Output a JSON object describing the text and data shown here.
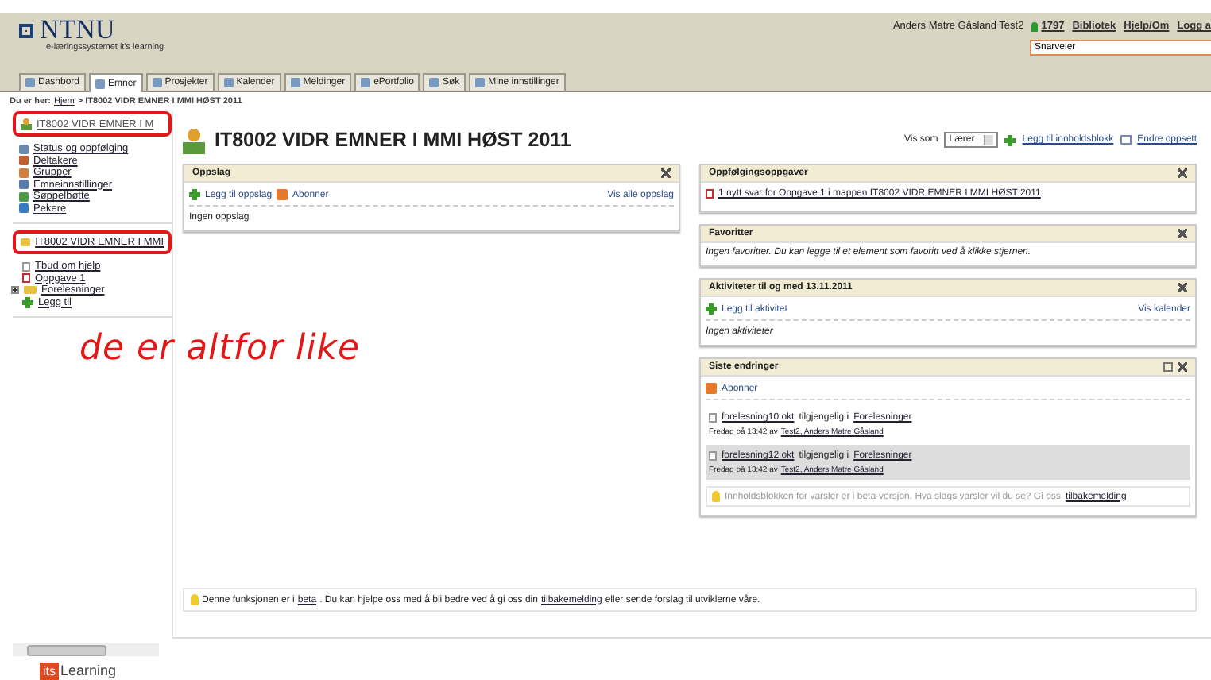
{
  "header": {
    "logo": "NTNU",
    "subtitle": "e-læringssystemet it's learning",
    "user": "Anders Matre Gåsland Test2",
    "links": [
      {
        "label": "1797",
        "kind": "online"
      },
      {
        "label": "Bibliotek",
        "kind": "link"
      },
      {
        "label": "Hjelp/Om",
        "kind": "link"
      },
      {
        "label": "Logg a",
        "kind": "link"
      }
    ],
    "search": {
      "value": "Snarveier"
    }
  },
  "tabs": [
    {
      "label": "Dashbord",
      "selected": false
    },
    {
      "label": "Emner",
      "selected": true
    },
    {
      "label": "Prosjekter",
      "selected": false
    },
    {
      "label": "Kalender",
      "selected": false
    },
    {
      "label": "Meldinger",
      "selected": false
    },
    {
      "label": "ePortfolio",
      "selected": false
    },
    {
      "label": "Søk",
      "selected": false
    },
    {
      "label": "Mine innstillinger",
      "selected": false
    }
  ],
  "breadcrumb": {
    "prefix": "Du er her:",
    "home": "Hjem",
    "current": "> IT8002 VIDR EMNER I MMI HØST 2011"
  },
  "sidebar": {
    "course": "IT8002 VIDR EMNER I M",
    "items": [
      {
        "label": "Status og oppfølging"
      },
      {
        "label": "Deltakere"
      },
      {
        "label": "Grupper"
      },
      {
        "label": "Emneinnstillinger"
      },
      {
        "label": "Søppelbøtte"
      },
      {
        "label": "Pekere"
      }
    ],
    "folder": "IT8002 VIDR EMNER I MMI",
    "tree": [
      {
        "label": "Tbud om hjelp",
        "kind": "doc"
      },
      {
        "label": "Oppgave 1",
        "kind": "task"
      },
      {
        "label": "Forelesninger",
        "kind": "folder",
        "expanded": false
      },
      {
        "label": "Legg til",
        "kind": "add"
      }
    ]
  },
  "annotation": {
    "text": "de er altfor like"
  },
  "page": {
    "title": "IT8002 VIDR EMNER I MMI HØST 2011",
    "view_as_label": "Vis som",
    "view_as": "Lærer",
    "add_block": "Legg til innholdsblokk",
    "layout": "Endre oppsett"
  },
  "oppslag": {
    "title": "Oppslag",
    "add": "Legg til oppslag",
    "subscribe": "Abonner",
    "all": "Vis alle oppslag",
    "empty": "Ingen oppslag"
  },
  "followup": {
    "title": "Oppfølgingsoppgaver",
    "item": "1 nytt svar for Oppgave 1 i mappen IT8002 VIDR EMNER I MMI HØST 2011"
  },
  "favorites": {
    "title": "Favoritter",
    "text": "Ingen favoritter. Du kan legge til et element som favoritt ved å klikke stjernen."
  },
  "activities": {
    "title": "Aktiviteter til og med 13.11.2011",
    "add": "Legg til aktivitet",
    "calendar": "Vis kalender",
    "empty": "Ingen aktiviteter"
  },
  "changes": {
    "title": "Siste endringer",
    "subscribe": "Abonner",
    "items": [
      {
        "file": "forelesning10.okt",
        "mid": "tilgjengelig i",
        "folder": "Forelesninger",
        "meta": "Fredag på 13:42 av",
        "author": "Test2, Anders Matre Gåsland",
        "selected": false
      },
      {
        "file": "forelesning12.okt",
        "mid": "tilgjengelig i",
        "folder": "Forelesninger",
        "meta": "Fredag på 13:42 av",
        "author": "Test2, Anders Matre Gåsland",
        "selected": true
      }
    ],
    "beta_text": "Innholdsblokken for varsler er i beta-versjon. Hva slags varsler vil du se? Gi oss",
    "beta_link": "tilbakemelding"
  },
  "beta_bar": {
    "a": "Denne funksjonen er i",
    "link1": "beta",
    "b": ". Du kan hjelpe oss med å bli bedre ved å gi oss din",
    "link2": "tilbakemelding",
    "c": "eller sende forslag til utviklerne våre."
  },
  "footer": {
    "logo_a": "its",
    "logo_b": "Learning"
  }
}
